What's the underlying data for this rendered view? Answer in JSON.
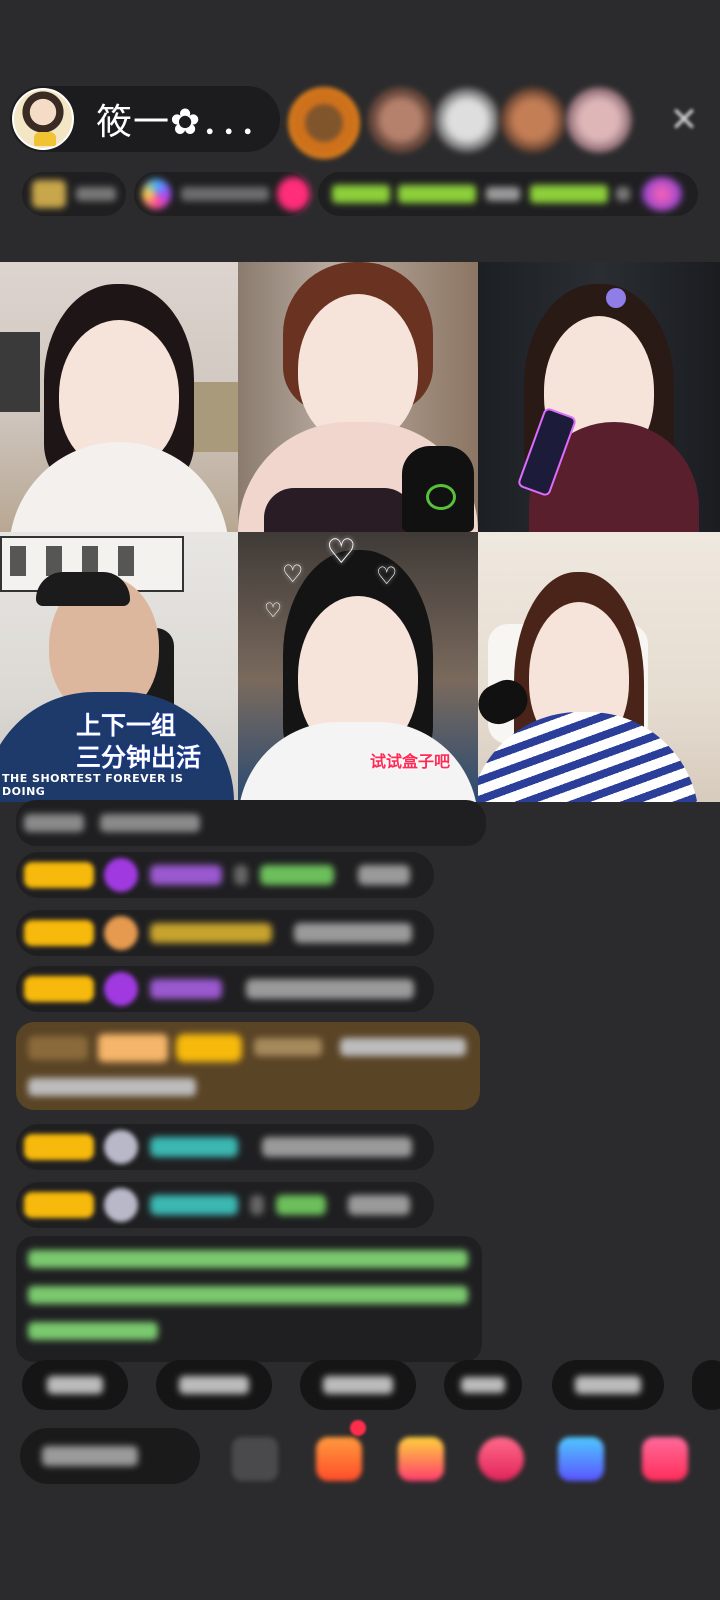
{
  "host": {
    "name": "筱一✿．．．"
  },
  "video_tiles": [
    {
      "caption_lines": []
    },
    {
      "caption_lines": []
    },
    {
      "caption_lines": []
    },
    {
      "caption_lines": [
        "上下一组",
        "三分钟出活"
      ],
      "shirt_text": "THE SHORTEST FOREVER IS DOING"
    },
    {
      "caption_lines": [
        "试试盒子吧"
      ]
    },
    {
      "caption_lines": []
    }
  ],
  "colors": {
    "background": "#2b2b2d",
    "badge_yellow": "#f6b90c",
    "chat_green": "#7bc96f",
    "chat_teal": "#3cb7b2",
    "chat_purple": "#9b59d0"
  }
}
